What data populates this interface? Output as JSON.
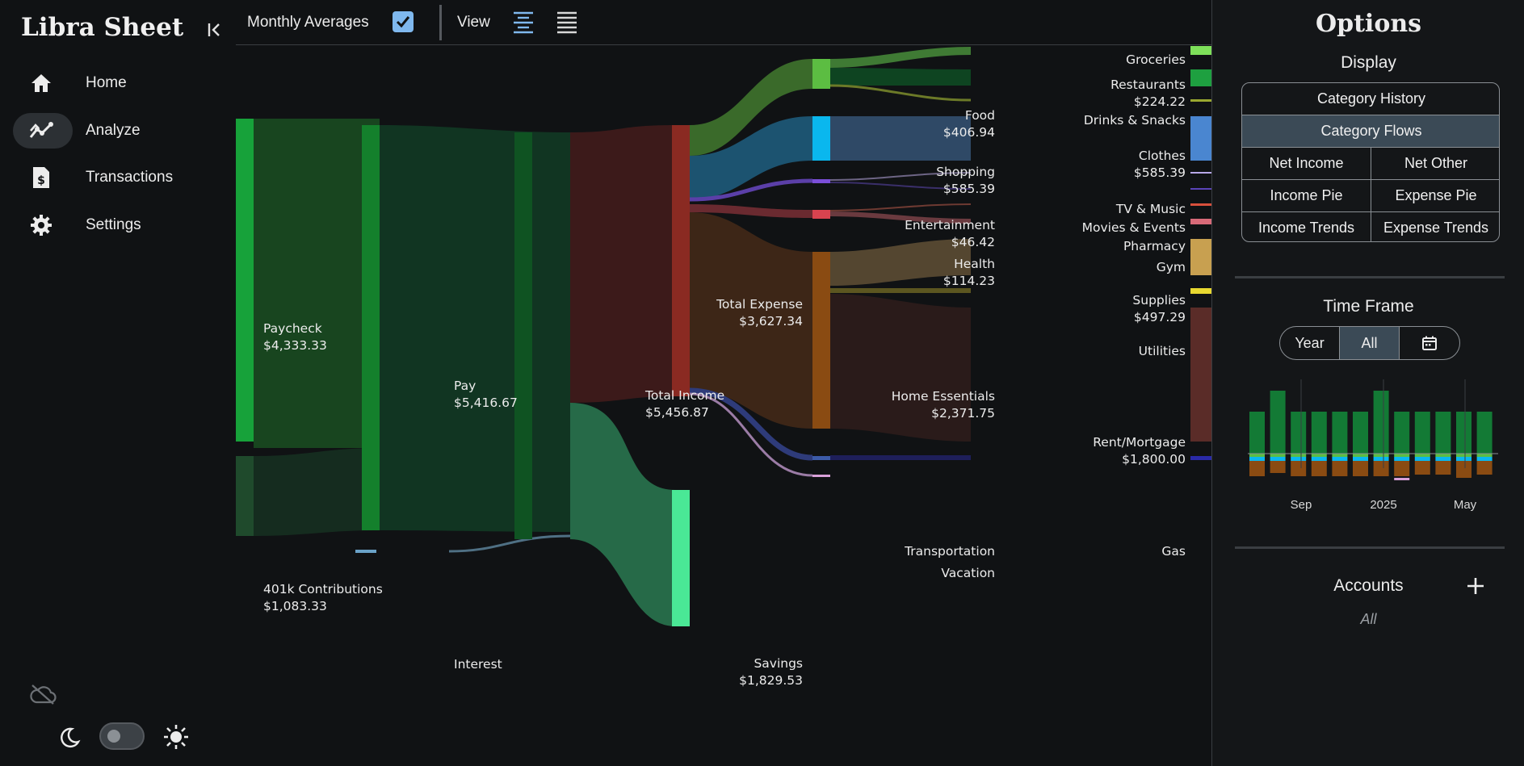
{
  "app": {
    "title": "Libra Sheet"
  },
  "sidebar": {
    "items": [
      {
        "label": "Home",
        "icon": "home-icon"
      },
      {
        "label": "Analyze",
        "icon": "analyze-icon",
        "active": true
      },
      {
        "label": "Transactions",
        "icon": "transactions-icon"
      },
      {
        "label": "Settings",
        "icon": "gear-icon"
      }
    ],
    "toggle_state": "off"
  },
  "toolbar": {
    "monthly_averages_label": "Monthly Averages",
    "monthly_averages_checked": true,
    "view_label": "View"
  },
  "sankey": {
    "nodes": {
      "paycheck": {
        "name": "Paycheck",
        "value": "$4,333.33"
      },
      "k401": {
        "name": "401k Contributions",
        "value": "$1,083.33"
      },
      "pay": {
        "name": "Pay",
        "value": "$5,416.67"
      },
      "interest": {
        "name": "Interest"
      },
      "total_income": {
        "name": "Total Income",
        "value": "$5,456.87"
      },
      "total_expense": {
        "name": "Total Expense",
        "value": "$3,627.34"
      },
      "savings": {
        "name": "Savings",
        "value": "$1,829.53"
      },
      "food": {
        "name": "Food",
        "value": "$406.94"
      },
      "shopping": {
        "name": "Shopping",
        "value": "$585.39"
      },
      "entertainment": {
        "name": "Entertainment",
        "value": "$46.42"
      },
      "health": {
        "name": "Health",
        "value": "$114.23"
      },
      "home": {
        "name": "Home Essentials",
        "value": "$2,371.75"
      },
      "transportation": {
        "name": "Transportation"
      },
      "vacation": {
        "name": "Vacation"
      },
      "groceries": {
        "name": "Groceries"
      },
      "restaurants": {
        "name": "Restaurants",
        "value": "$224.22"
      },
      "drinks": {
        "name": "Drinks & Snacks"
      },
      "clothes": {
        "name": "Clothes",
        "value": "$585.39"
      },
      "tv": {
        "name": "TV & Music"
      },
      "movies": {
        "name": "Movies & Events"
      },
      "pharmacy": {
        "name": "Pharmacy"
      },
      "gym": {
        "name": "Gym"
      },
      "supplies": {
        "name": "Supplies",
        "value": "$497.29"
      },
      "utilities": {
        "name": "Utilities"
      },
      "rent": {
        "name": "Rent/Mortgage",
        "value": "$1,800.00"
      },
      "gas": {
        "name": "Gas"
      }
    },
    "colors": {
      "income": "#1a9e3a",
      "expense": "#8a2a22",
      "savings": "#4ae896",
      "food": "#5cbd42",
      "shopping": "#0ab7ee",
      "entertainment": "#7b4fd8",
      "health": "#d8434f",
      "home": "#8a4b12"
    }
  },
  "options": {
    "title": "Options",
    "display_title": "Display",
    "display_buttons": {
      "category_history": "Category History",
      "category_flows": "Category Flows",
      "net_income": "Net Income",
      "net_other": "Net Other",
      "income_pie": "Income Pie",
      "expense_pie": "Expense Pie",
      "income_trends": "Income Trends",
      "expense_trends": "Expense Trends"
    },
    "selected_display": "Category Flows",
    "timeframe_title": "Time Frame",
    "timeframe": {
      "year": "Year",
      "all": "All",
      "selected": "All"
    },
    "mini_chart": {
      "tick_labels": [
        "Sep",
        "2025",
        "May"
      ]
    },
    "accounts_title": "Accounts",
    "accounts_value": "All"
  }
}
